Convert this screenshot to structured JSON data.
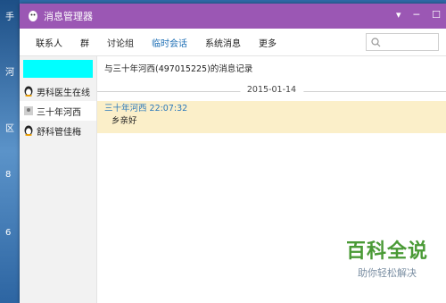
{
  "desktop": {
    "glyphs": [
      "手",
      "河",
      "区",
      "8",
      "6"
    ]
  },
  "window": {
    "title": "消息管理器"
  },
  "nav": {
    "items": [
      "联系人",
      "群",
      "讨论组",
      "临时会话",
      "系统消息",
      "更多"
    ],
    "active_index": 3,
    "search_placeholder": ""
  },
  "sidebar": {
    "items": [
      "男科医生在线",
      "三十年河西",
      "舒科管佳梅"
    ],
    "selected_index": 1
  },
  "content": {
    "header": "与三十年河西(497015225)的消息记录",
    "date": "2015-01-14",
    "message": {
      "meta": "三十年河西 22:07:32",
      "text": "乡亲好"
    }
  },
  "watermark": {
    "main": "百科全说",
    "sub": "助你轻松解决"
  },
  "colors": {
    "titlebar": "#9b57b4",
    "accent": "#1e6fb5",
    "highlight": "#fbefc9"
  }
}
